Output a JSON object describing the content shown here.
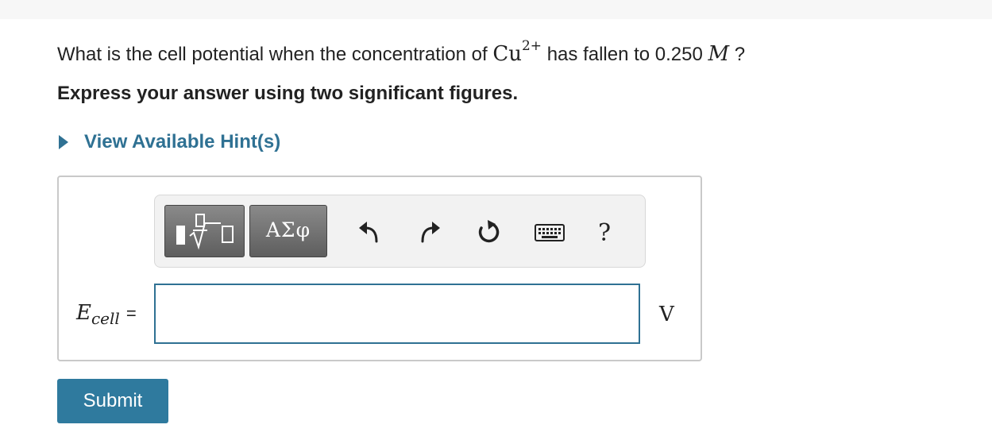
{
  "question": {
    "prefix": "What is the cell potential when the concentration of ",
    "ion": "Cu",
    "ion_charge": "2+",
    "middle": " has fallen to 0.250 ",
    "unit_symbol": "M",
    "suffix": " ?"
  },
  "instruction": "Express your answer using two significant figures.",
  "hint_link": "View Available Hint(s)",
  "toolbar": {
    "templates_icon": "fraction-sqrt-template-icon",
    "symbols_label": "ΑΣφ",
    "undo_icon": "undo-icon",
    "redo_icon": "redo-icon",
    "reset_icon": "reset-icon",
    "keyboard_icon": "keyboard-icon",
    "help_label": "?"
  },
  "answer": {
    "var": "E",
    "var_sub": "cell",
    "equals": "=",
    "value": "",
    "unit": "V"
  },
  "submit_label": "Submit",
  "colors": {
    "link": "#2f7193",
    "submit_bg": "#2f7a9e",
    "input_border": "#2f7193",
    "toolbar_button": "#6e6e6e"
  }
}
